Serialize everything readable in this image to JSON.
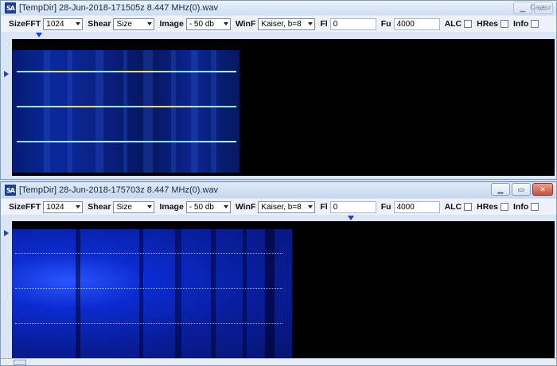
{
  "caption_label": "Captur",
  "windows": [
    {
      "title": "[TempDir] 28-Jun-2018-171505z 8.447 MHz(0).wav",
      "toolbar": {
        "sizefft_label": "SizeFFT",
        "sizefft_value": "1024",
        "shear_label": "Shear",
        "shear_value": "Size",
        "image_label": "Image",
        "image_value": "- 50 db",
        "winf_label": "WinF",
        "winf_value": "Kaiser, b=8",
        "fl_label": "Fl",
        "fl_value": "0",
        "fu_label": "Fu",
        "fu_value": "4000",
        "alc_label": "ALC",
        "hres_label": "HRes",
        "info_label": "Info"
      }
    },
    {
      "title": "[TempDir] 28-Jun-2018-175703z 8.447 MHz(0).wav",
      "toolbar": {
        "sizefft_label": "SizeFFT",
        "sizefft_value": "1024",
        "shear_label": "Shear",
        "shear_value": "Size",
        "image_label": "Image",
        "image_value": "- 50 db",
        "winf_label": "WinF",
        "winf_value": "Kaiser, b=8",
        "fl_label": "Fl",
        "fl_value": "0",
        "fu_label": "Fu",
        "fu_value": "4000",
        "alc_label": "ALC",
        "hres_label": "HRes",
        "info_label": "Info"
      }
    }
  ],
  "icons": {
    "app": "sa-app-icon",
    "minimize": "minimize-icon",
    "maximize": "maximize-icon",
    "close": "close-icon"
  },
  "colors": {
    "marker": "#1a3fd6",
    "spectrum_dark": "#061a72",
    "spectrum_bright": "#2a55ff",
    "signal_line": "#7fe6ff",
    "signal_hot": "#ffe24a"
  }
}
